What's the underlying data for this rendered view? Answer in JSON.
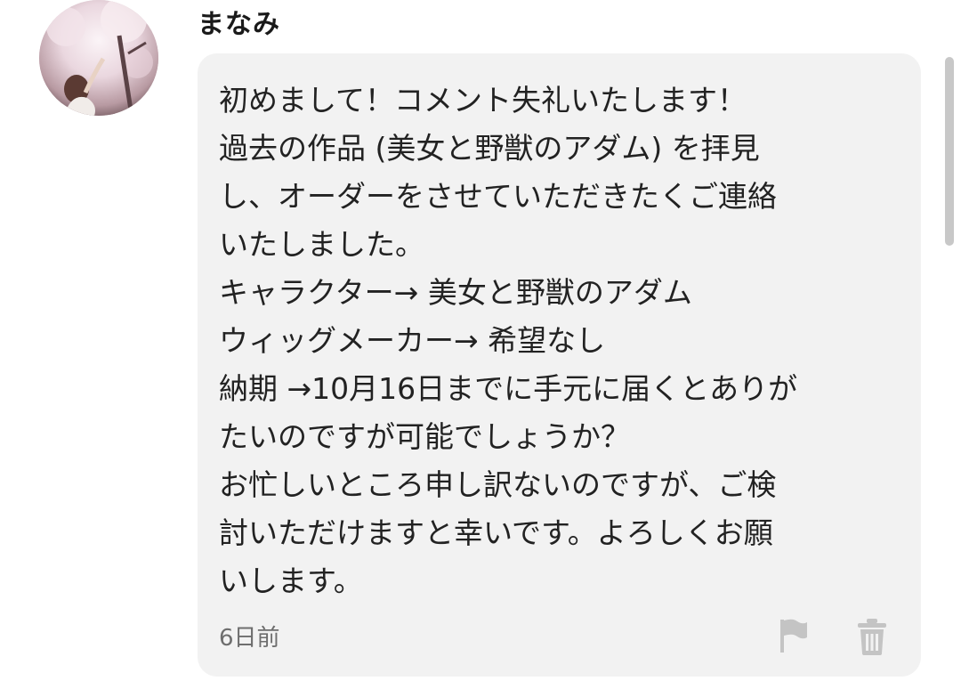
{
  "comment": {
    "author": "まなみ",
    "avatar_icon": "user-avatar-photo",
    "message_lines": [
      "初めまして！コメント失礼いたします！",
      "過去の作品 (美女と野獣のアダム) を拝見",
      "し、オーダーをさせていただきたくご連絡",
      "いたしました。",
      "キャラクター→ 美女と野獣のアダム",
      "ウィッグメーカー→ 希望なし",
      "納期 →10月16日までに手元に届くとありが",
      "たいのですが可能でしょうか？",
      "お忙しいところ申し訳ないのですが、ご検",
      "討いただけますと幸いです。よろしくお願",
      "いします。"
    ],
    "timestamp": "6日前",
    "actions": {
      "report_icon": "flag-icon",
      "delete_icon": "trash-icon"
    }
  },
  "colors": {
    "bubble_background": "#f2f2f2",
    "text": "#222222",
    "muted_text": "#6e6e6e",
    "icon": "#c4c4c4",
    "scrollbar": "#c8c8c8"
  }
}
